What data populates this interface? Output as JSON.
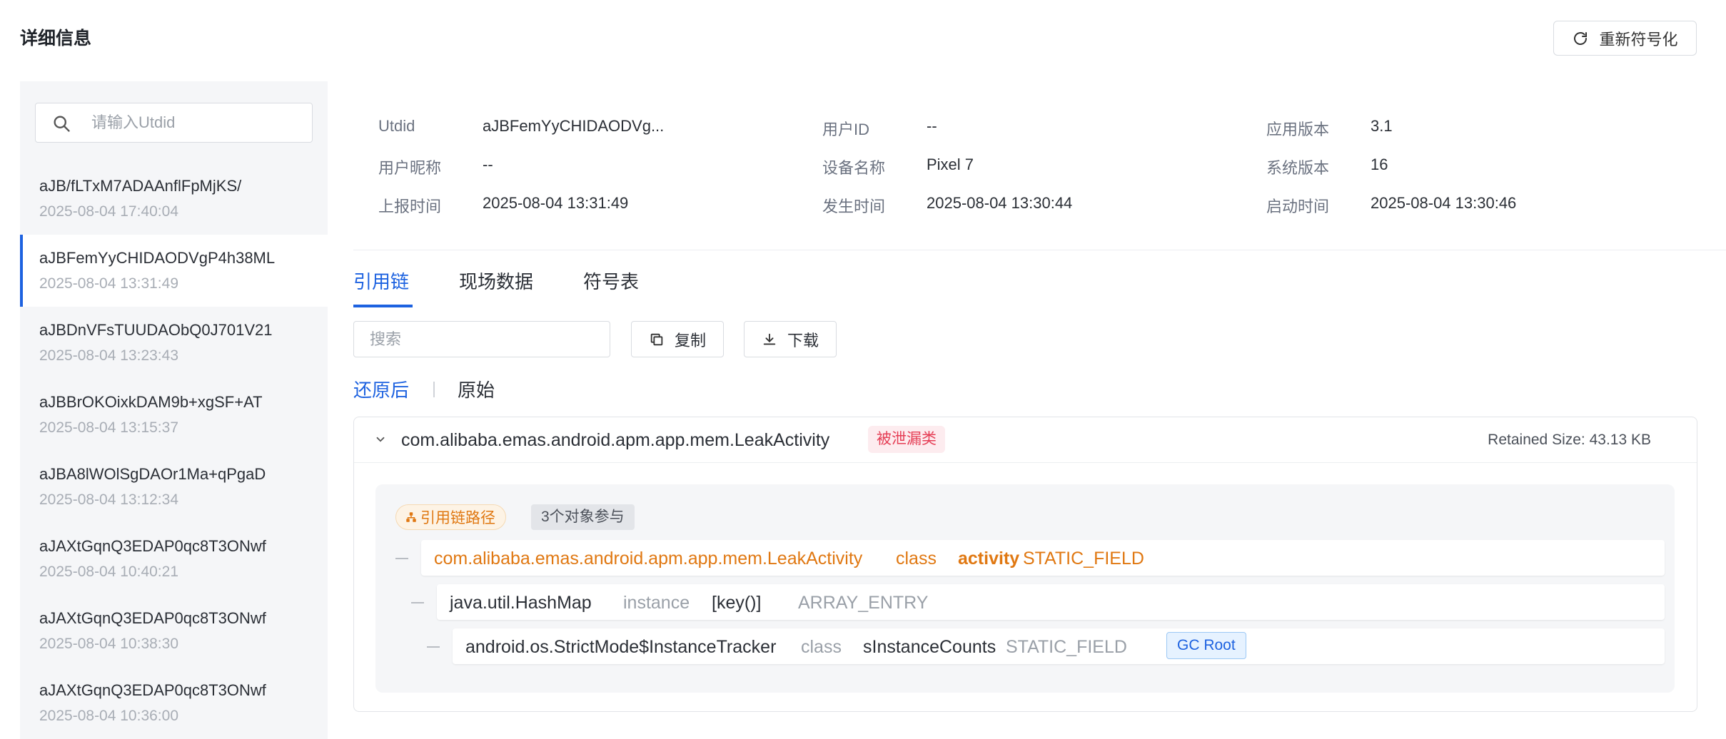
{
  "header": {
    "title": "详细信息",
    "resymbolize_label": "重新符号化"
  },
  "sidebar": {
    "search_placeholder": "请输入Utdid",
    "records": [
      {
        "id": "aJB/fLTxM7ADAAnflFpMjKS/",
        "time": "2025-08-04 17:40:04",
        "active": false
      },
      {
        "id": "aJBFemYyCHIDAODVgP4h38ML",
        "time": "2025-08-04 13:31:49",
        "active": true
      },
      {
        "id": "aJBDnVFsTUUDAObQ0J701V21",
        "time": "2025-08-04 13:23:43",
        "active": false
      },
      {
        "id": "aJBBrOKOixkDAM9b+xgSF+AT",
        "time": "2025-08-04 13:15:37",
        "active": false
      },
      {
        "id": "aJBA8lWOlSgDAOr1Ma+qPgaD",
        "time": "2025-08-04 13:12:34",
        "active": false
      },
      {
        "id": "aJAXtGqnQ3EDAP0qc8T3ONwf",
        "time": "2025-08-04 10:40:21",
        "active": false
      },
      {
        "id": "aJAXtGqnQ3EDAP0qc8T3ONwf",
        "time": "2025-08-04 10:38:30",
        "active": false
      },
      {
        "id": "aJAXtGqnQ3EDAP0qc8T3ONwf",
        "time": "2025-08-04 10:36:00",
        "active": false
      }
    ]
  },
  "info": {
    "utdid_label": "Utdid",
    "utdid_value": "aJBFemYyCHIDAODVg...",
    "user_id_label": "用户ID",
    "user_id_value": "--",
    "app_version_label": "应用版本",
    "app_version_value": "3.1",
    "nickname_label": "用户昵称",
    "nickname_value": "--",
    "device_label": "设备名称",
    "device_value": "Pixel 7",
    "os_version_label": "系统版本",
    "os_version_value": "16",
    "report_time_label": "上报时间",
    "report_time_value": "2025-08-04 13:31:49",
    "occur_time_label": "发生时间",
    "occur_time_value": "2025-08-04 13:30:44",
    "launch_time_label": "启动时间",
    "launch_time_value": "2025-08-04 13:30:46"
  },
  "tabs": {
    "ref_chain": "引用链",
    "scene_data": "现场数据",
    "symbol_table": "符号表"
  },
  "toolbar": {
    "search_placeholder": "搜索",
    "copy_label": "复制",
    "download_label": "下载"
  },
  "view_toggle": {
    "restored": "还原后",
    "original": "原始"
  },
  "leak": {
    "class_name": "com.alibaba.emas.android.apm.app.mem.LeakActivity",
    "leak_tag": "被泄漏类",
    "retained_size": "Retained Size: 43.13 KB",
    "path_chip": "引用链路径",
    "count_chip": "3个对象参与",
    "chain": [
      {
        "name": "com.alibaba.emas.android.apm.app.mem.LeakActivity",
        "kind": "class",
        "field": "activity",
        "field_type": "STATIC_FIELD"
      },
      {
        "name": "java.util.HashMap",
        "kind": "instance",
        "field": "[key()]",
        "field_type": "ARRAY_ENTRY"
      },
      {
        "name": "android.os.StrictMode$InstanceTracker",
        "kind": "class",
        "field": "sInstanceCounts",
        "field_type": "STATIC_FIELD",
        "root_tag": "GC Root"
      }
    ]
  },
  "colors": {
    "accent": "#1d62e0",
    "leak_orange": "#e07812",
    "leak_tag_red": "#e53e55"
  }
}
